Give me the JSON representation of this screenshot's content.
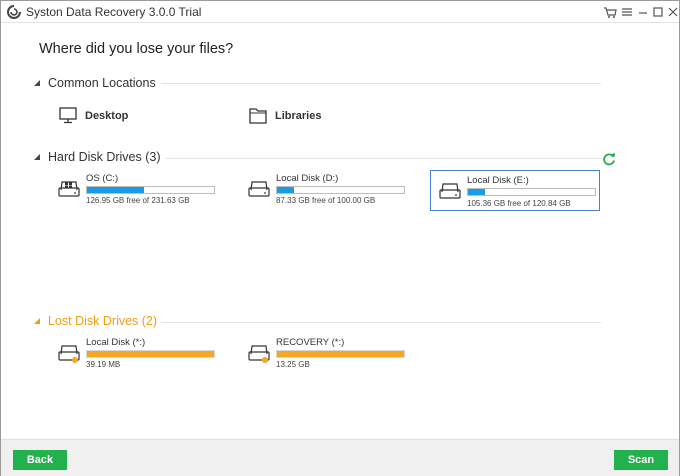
{
  "window": {
    "title": "Syston Data Recovery 3.0.0 Trial"
  },
  "page_title": "Where did you lose your files?",
  "colors": {
    "accent_green": "#22b14c",
    "accent_orange": "#f5a623",
    "bar_blue": "#1a9be8",
    "bar_orange": "#f5a623",
    "lost_header": "#f39c12",
    "selected_border": "#4a7fd0"
  },
  "common_locations": {
    "header": "Common Locations",
    "items": [
      {
        "label": "Desktop",
        "icon": "monitor-icon"
      },
      {
        "label": "Libraries",
        "icon": "folder-icon"
      }
    ]
  },
  "hard_disk_drives": {
    "header": "Hard Disk Drives (3)",
    "drives": [
      {
        "name": "OS (C:)",
        "size": "126.95 GB free of 231.63 GB",
        "used_fraction": 0.45,
        "icon": "windows-drive-icon",
        "selected": false
      },
      {
        "name": "Local Disk (D:)",
        "size": "87.33 GB free of 100.00 GB",
        "used_fraction": 0.13,
        "icon": "hard-drive-icon",
        "selected": false
      },
      {
        "name": "Local Disk (E:)",
        "size": "105.36 GB free of 120.84 GB",
        "used_fraction": 0.13,
        "icon": "hard-drive-icon",
        "selected": true
      }
    ]
  },
  "lost_disk_drives": {
    "header": "Lost Disk Drives (2)",
    "drives": [
      {
        "name": "Local Disk (*:)",
        "size": "39.19 MB",
        "used_fraction": 1.0,
        "icon": "lost-drive-icon"
      },
      {
        "name": "RECOVERY (*:)",
        "size": "13.25 GB",
        "used_fraction": 1.0,
        "icon": "lost-drive-icon"
      }
    ]
  },
  "footer": {
    "back_label": "Back",
    "scan_label": "Scan"
  }
}
